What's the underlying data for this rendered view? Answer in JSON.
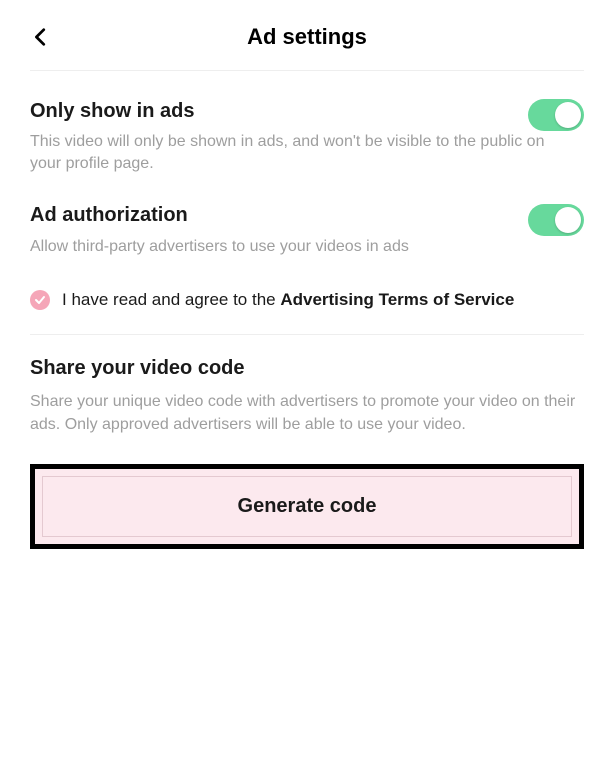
{
  "header": {
    "title": "Ad settings"
  },
  "onlyShow": {
    "title": "Only show in ads",
    "desc": "This video will only be shown in ads, and won't be visible to the public on your profile page."
  },
  "adAuth": {
    "title": "Ad authorization",
    "desc": "Allow third-party advertisers to use your videos in ads"
  },
  "agree": {
    "prefix": "I have read and agree to the ",
    "link": "Advertising Terms of Service"
  },
  "share": {
    "title": "Share your video code",
    "desc": "Share your unique video code with advertisers to promote your video on their ads. Only approved advertisers will be able to use your video."
  },
  "generate": {
    "label": "Generate code"
  }
}
